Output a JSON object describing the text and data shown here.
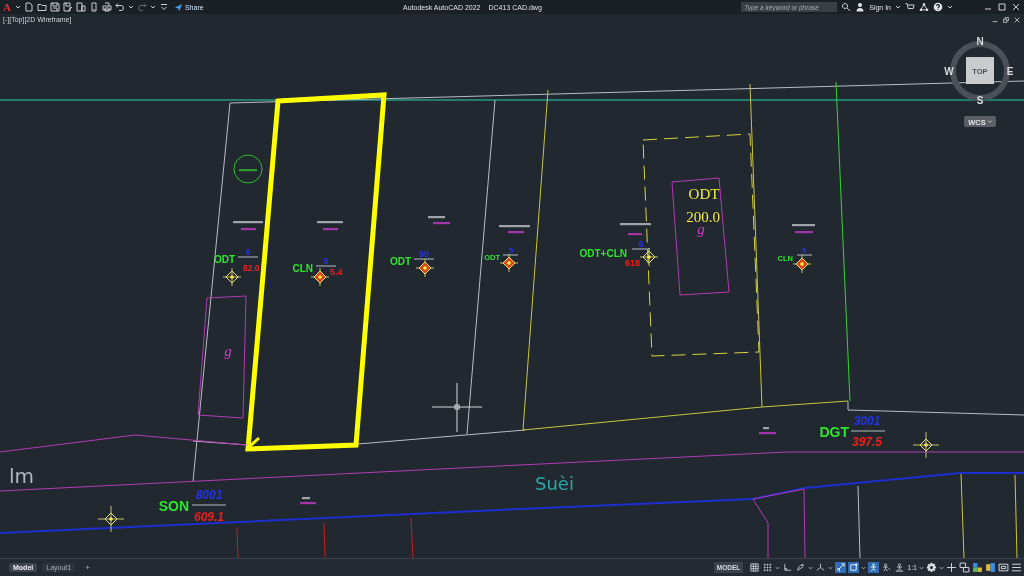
{
  "app": {
    "logo": "A",
    "share": "Share",
    "title": "Autodesk AutoCAD 2022",
    "file": "DC413 CAD.dwg",
    "search": {
      "placeholder": "Type a keyword or phrase"
    },
    "sign_in": "Sign In"
  },
  "viewport": {
    "label": "[-][Top][2D Wireframe]"
  },
  "viewcube": {
    "face": "TOP",
    "north": "N",
    "west": "W",
    "east": "E",
    "south": "S",
    "ucs": "WCS"
  },
  "drawing": {
    "parcel_labels": [
      {
        "code": "ODT",
        "number": "6",
        "area": "82.0",
        "marker_filled": false
      },
      {
        "code": "CLN",
        "number": "5",
        "area": "5.4",
        "marker_filled": true
      },
      {
        "code": "ODT",
        "number": "90",
        "marker_filled": true
      },
      {
        "code": "ODT",
        "number": "5",
        "marker_filled": true
      },
      {
        "code": "ODT+CLN",
        "number": "6",
        "area": "618",
        "marker_filled": false
      },
      {
        "code": "CLN",
        "number": "5",
        "marker_filled": true
      }
    ],
    "building": {
      "code": "ODT",
      "area": "200.0",
      "note": "g"
    },
    "notes": [
      "g"
    ],
    "road_labels": [
      {
        "code": "SON",
        "number": "8001",
        "area": "609.1"
      },
      {
        "code": "DGT",
        "number": "3001",
        "area": "397.5"
      }
    ],
    "place_names": [
      "lm",
      "Suèi"
    ]
  },
  "tabs": [
    {
      "label": "Model",
      "selected": true
    },
    {
      "label": "Layout1",
      "selected": false
    }
  ],
  "new_tab": "+",
  "status_bar": {
    "space": "MODEL",
    "toggles": [
      {
        "kind": "grid",
        "on": false,
        "menu": false
      },
      {
        "kind": "snap",
        "on": false,
        "menu": true
      },
      {
        "kind": "ortho",
        "on": false,
        "menu": false
      },
      {
        "kind": "polar",
        "on": false,
        "menu": true
      },
      {
        "kind": "isodraft",
        "on": false,
        "menu": true
      },
      {
        "kind": "tracking",
        "on": true,
        "menu": false
      },
      {
        "kind": "osnap",
        "on": true,
        "menu": true
      },
      {
        "kind": "annotation_visibility",
        "on": true,
        "menu": false
      },
      {
        "kind": "autoscale",
        "on": false,
        "menu": false
      },
      {
        "kind": "annotation_scale",
        "on": false,
        "menu": false
      }
    ],
    "scale": "1:1"
  }
}
